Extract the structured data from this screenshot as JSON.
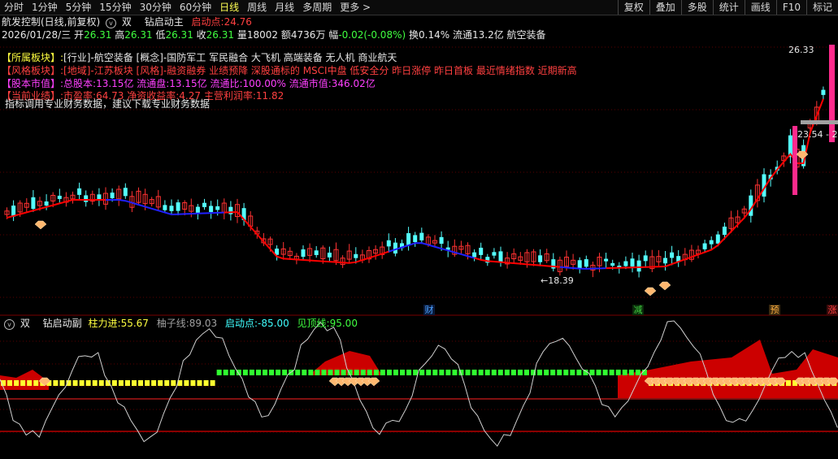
{
  "toolbar": {
    "left_items": [
      "分时",
      "1分钟",
      "5分钟",
      "15分钟",
      "30分钟",
      "60分钟",
      "日线",
      "周线",
      "月线",
      "多周期",
      "更多 >"
    ],
    "active": "日线",
    "right_items": [
      "复权",
      "叠加",
      "多股",
      "统计",
      "画线",
      "F10",
      "标记"
    ]
  },
  "title": {
    "name": "航发控制(日线,前复权)",
    "icon": "circle-chevron-down-icon",
    "mode": "双",
    "indicator": "钻启动主",
    "start_label": "启动点:",
    "start_value": "24.76"
  },
  "quote": {
    "date": "2026/01/28/三",
    "open_label": "开",
    "open": "26.31",
    "high_label": "高",
    "high": "26.31",
    "low_label": "低",
    "low": "26.31",
    "close_label": "收",
    "close": "26.31",
    "vol_label": "量",
    "vol": "18002",
    "amount_label": "额",
    "amount": "4736万",
    "change_label": "幅",
    "change": "-0.02(-0.08%)",
    "turnover_label": "换",
    "turnover": "0.14%",
    "float_label": "流通",
    "float": "13.2亿",
    "sector": "航空装备"
  },
  "info": {
    "l1_tag": "【所属板块】:",
    "l1_text": "[行业]-航空装备 [概念]-国防军工 军民融合 大飞机 高端装备 无人机 商业航天",
    "l2_tag": "【风格板块】:",
    "l2_text": "[地域]-江苏板块 [风格]-融资融券 业绩预降 深股通标的 MSCI中盘 低安全分 昨日涨停 昨日首板 最近情绪指数 近期新高",
    "l3_tag": "【股本市值】:",
    "l3_text": "总股本:13.15亿 流通盘:13.15亿 流通比:100.00% 流通市值:346.02亿",
    "l4_tag": "【当前业绩】:",
    "l4_text": "市盈率:64.73 净资收益率:4.27 主营利润率:11.82",
    "l5_text": "指标调用专业财务数据，建议下载专业财务数据"
  },
  "price_labels": {
    "high": "26.33",
    "low": "18.39",
    "range": "23.54 - 2"
  },
  "event_markers": [
    {
      "label": "财",
      "color": "#4aa0ff"
    },
    {
      "label": "减",
      "color": "#40d040"
    },
    {
      "label": "预",
      "color": "#ffb040"
    },
    {
      "label": "涨",
      "color": "#ff4040"
    }
  ],
  "sub": {
    "mode": "双",
    "name": "钻启动副",
    "l1": "柱力进:",
    "v1": "55.67",
    "l2": "柚子线:",
    "v2": "89.03",
    "l3": "启动点:",
    "v3": "-85.00",
    "l4": "见顶线:",
    "v4": "95.00"
  },
  "colors": {
    "up": "#ff3232",
    "down": "#54ffff",
    "ma": "#ff0000",
    "ma_down": "#2020ff",
    "bg": "#000000"
  }
}
